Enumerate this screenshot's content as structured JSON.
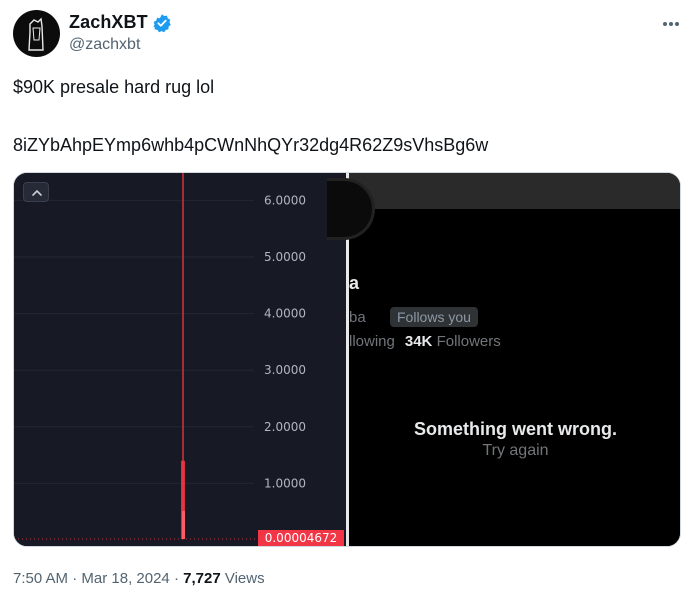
{
  "author": {
    "display_name": "ZachXBT",
    "handle": "@zachxbt"
  },
  "tweet": {
    "text_line1": "$90K presale hard rug lol",
    "text_line2": "8iZYbAhpEYmp6whb4pCWnNhQYr32dg4R62Z9sVhsBg6w"
  },
  "chart": {
    "price_labels": [
      "6.0000",
      "5.0000",
      "4.0000",
      "3.0000",
      "2.0000",
      "1.0000"
    ],
    "last_price": "0.00004672",
    "watermark_text": "ba"
  },
  "chart_data": {
    "type": "candlestick",
    "ylim": [
      0,
      6.5
    ],
    "y_ticks": [
      6,
      5,
      4,
      3,
      2,
      1
    ],
    "spike_high": 6.6,
    "spike_body_top": 1.4,
    "last_price": 4.672e-05,
    "colors": {
      "spike": "#f23645",
      "background": "#171a25"
    }
  },
  "profile": {
    "name_partial": "a",
    "handle_partial": "ba",
    "follows_you": "Follows you",
    "following_partial": "llowing",
    "followers_count": "34K",
    "followers_label": "Followers",
    "error_title": "Something went wrong.",
    "try_again": "Try again"
  },
  "footer": {
    "time": "7:50 AM",
    "separator": " · ",
    "date": "Mar 18, 2024",
    "views_count": "7,727",
    "views_label": "Views"
  },
  "colors": {
    "verified": "#1d9bf0",
    "chart_bg": "#171a25",
    "spike": "#f23645"
  },
  "icons": [
    "verified-badge-icon",
    "more-options-icon",
    "chevron-up-icon"
  ]
}
